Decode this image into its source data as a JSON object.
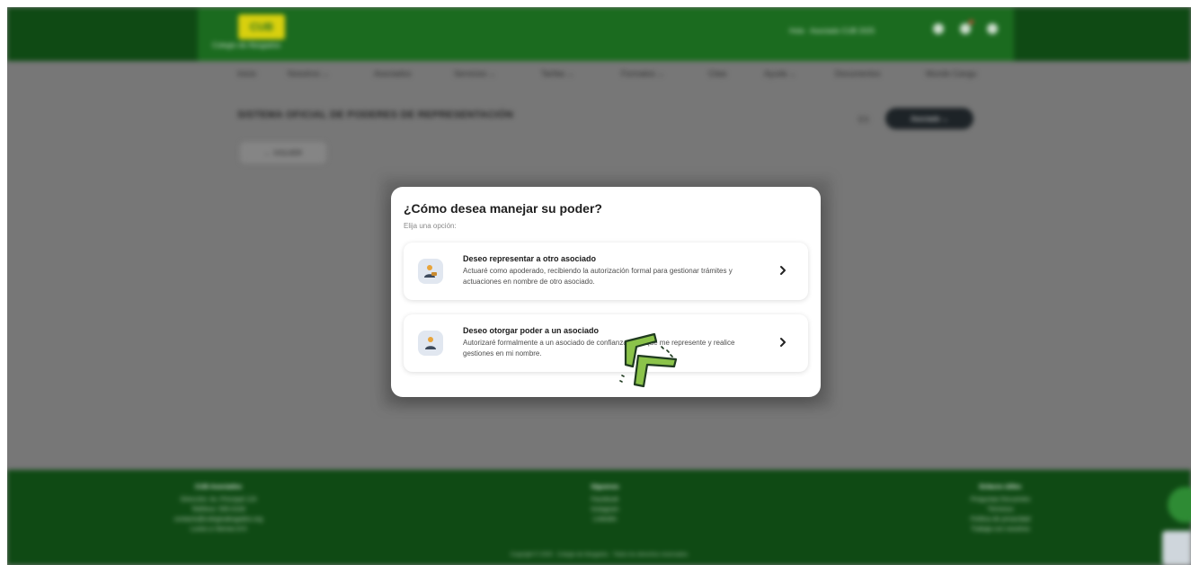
{
  "background_page": {
    "logo_text": "CUB",
    "logo_subtitle": "Colegio de Abogados",
    "user_text": "Hola · Asociado CUB 2025",
    "nav_items": [
      "Inicio",
      "Nosotros ⌄",
      "Asociados",
      "Servicios ⌄",
      "Tarifas ⌄",
      "Formatos ⌄",
      "Citas",
      "Ayuda ⌄",
      "Documentos",
      "Mundo Cangu"
    ],
    "page_heading": "SISTEMA OFICIAL DE PODERES DE REPRESENTACIÓN",
    "lang_label": "ES",
    "pill_label": "Asociado ⌄",
    "back_button_label": "← VOLVER",
    "footer": {
      "columns": [
        {
          "heading": "CUB Asociados",
          "lines": [
            "Dirección: Av. Principal 123",
            "Teléfono: 555-0100",
            "contacto@colegioabogados.org",
            "Lunes a Viernes 8-5"
          ]
        },
        {
          "heading": "Síguenos",
          "lines": [
            "Facebook",
            "Instagram",
            "LinkedIn"
          ]
        },
        {
          "heading": "Enlaces útiles",
          "lines": [
            "Preguntas frecuentes",
            "Términos",
            "Política de privacidad",
            "Trabaja con nosotros"
          ]
        }
      ],
      "copyright": "Copyright © 2025 · Colegio de Abogados · Todos los derechos reservados"
    }
  },
  "modal": {
    "title": "¿Cómo desea manejar su poder?",
    "subtitle": "Elija una opción:",
    "options": [
      {
        "title": "Deseo representar a otro asociado",
        "description": "Actuaré como apoderado, recibiendo la autorización formal para gestionar trámites y actuaciones en nombre de otro asociado.",
        "icon": "representative-user-icon"
      },
      {
        "title": "Deseo otorgar poder a un asociado",
        "description": "Autorizaré formalmente a un asociado de confianza para que me represente y realice gestiones en mi nombre.",
        "icon": "grant-power-user-icon"
      }
    ]
  },
  "colors": {
    "brand_green": "#1b6b1f",
    "dark_green": "#0f4a14",
    "logo_yellow": "#d8d00e",
    "cursor_green": "#8bc34a"
  }
}
